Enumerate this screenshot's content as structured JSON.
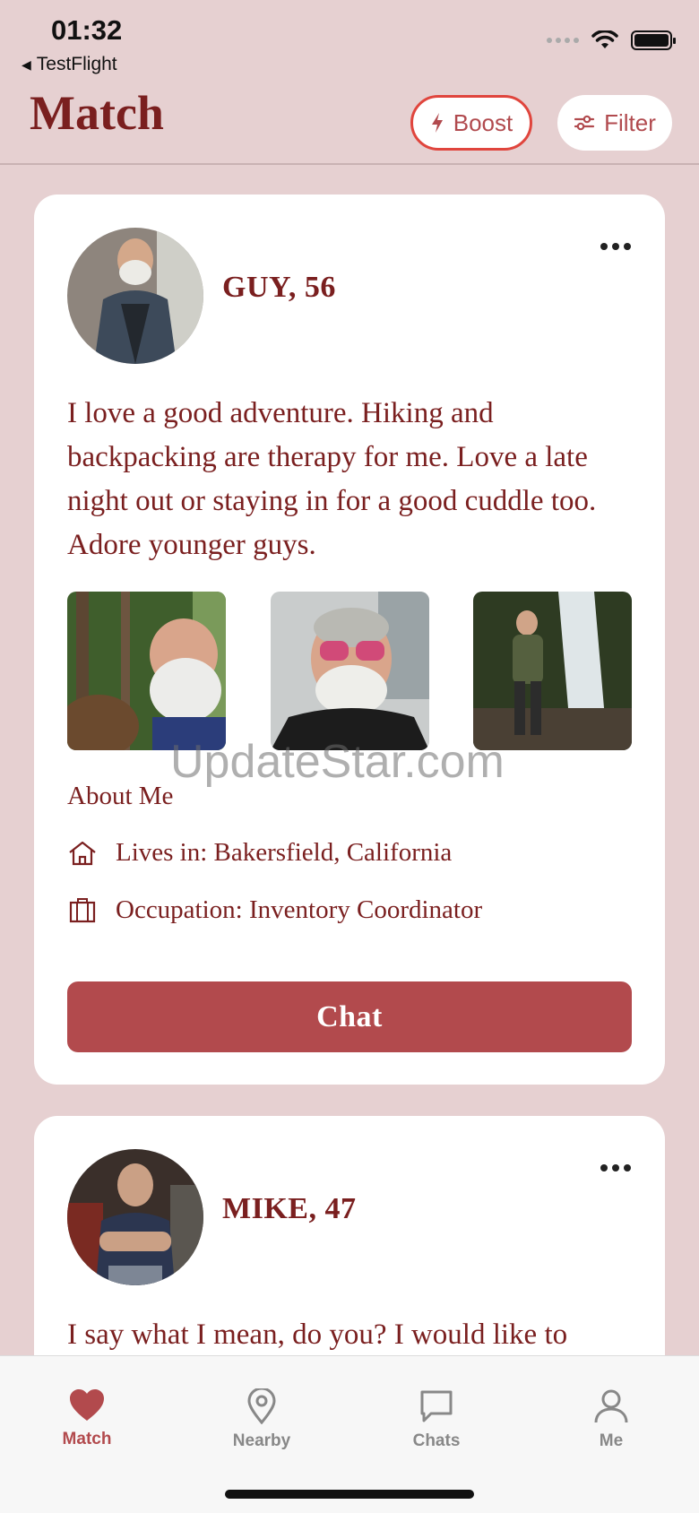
{
  "status_bar": {
    "time": "01:32",
    "back_app": "TestFlight"
  },
  "header": {
    "title": "Match",
    "boost_label": "Boost",
    "filter_label": "Filter"
  },
  "cards": [
    {
      "name_age": "GUY, 56",
      "bio": "I love a good adventure. Hiking and backpacking are therapy for me. Love a late night out or staying in for a good cuddle too. Adore younger guys.",
      "about_title": "About Me",
      "lives_in": "Lives in: Bakersfield, California",
      "occupation": "Occupation: Inventory Coordinator",
      "chat_label": "Chat"
    },
    {
      "name_age": "MIKE, 47",
      "bio": "I say what I mean, do you? I would like to"
    }
  ],
  "watermark": "UpdateStar.com",
  "tabs": [
    {
      "label": "Match",
      "icon": "heart-icon",
      "active": true
    },
    {
      "label": "Nearby",
      "icon": "location-pin-icon",
      "active": false
    },
    {
      "label": "Chats",
      "icon": "chat-bubble-icon",
      "active": false
    },
    {
      "label": "Me",
      "icon": "person-icon",
      "active": false
    }
  ],
  "colors": {
    "accent": "#b24a4d",
    "text": "#7a1f1f",
    "background": "#e6d0d1",
    "boost_border": "#e0453d"
  }
}
